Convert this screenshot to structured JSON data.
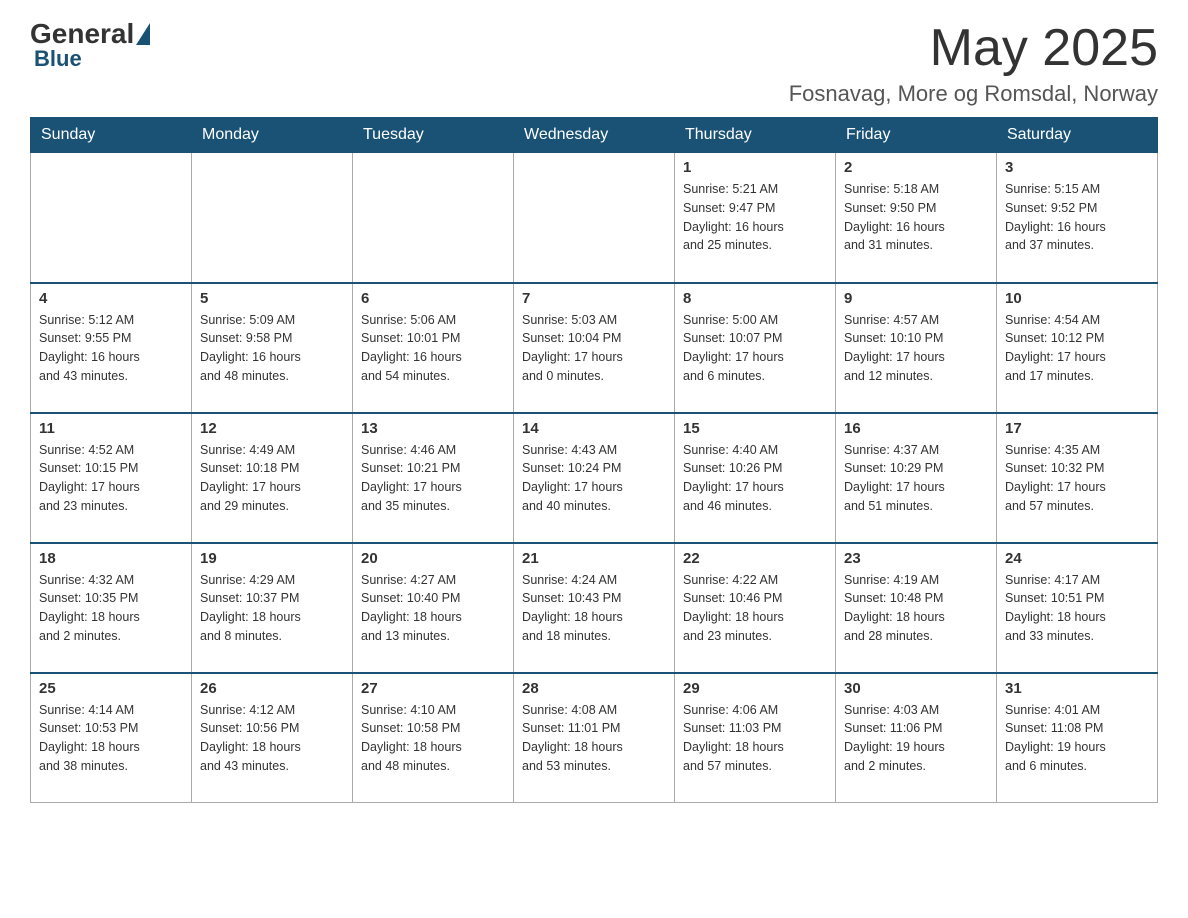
{
  "header": {
    "logo": {
      "general": "General",
      "blue": "Blue"
    },
    "title": "May 2025",
    "location": "Fosnavag, More og Romsdal, Norway"
  },
  "weekdays": [
    "Sunday",
    "Monday",
    "Tuesday",
    "Wednesday",
    "Thursday",
    "Friday",
    "Saturday"
  ],
  "weeks": [
    [
      {
        "day": "",
        "info": ""
      },
      {
        "day": "",
        "info": ""
      },
      {
        "day": "",
        "info": ""
      },
      {
        "day": "",
        "info": ""
      },
      {
        "day": "1",
        "info": "Sunrise: 5:21 AM\nSunset: 9:47 PM\nDaylight: 16 hours\nand 25 minutes."
      },
      {
        "day": "2",
        "info": "Sunrise: 5:18 AM\nSunset: 9:50 PM\nDaylight: 16 hours\nand 31 minutes."
      },
      {
        "day": "3",
        "info": "Sunrise: 5:15 AM\nSunset: 9:52 PM\nDaylight: 16 hours\nand 37 minutes."
      }
    ],
    [
      {
        "day": "4",
        "info": "Sunrise: 5:12 AM\nSunset: 9:55 PM\nDaylight: 16 hours\nand 43 minutes."
      },
      {
        "day": "5",
        "info": "Sunrise: 5:09 AM\nSunset: 9:58 PM\nDaylight: 16 hours\nand 48 minutes."
      },
      {
        "day": "6",
        "info": "Sunrise: 5:06 AM\nSunset: 10:01 PM\nDaylight: 16 hours\nand 54 minutes."
      },
      {
        "day": "7",
        "info": "Sunrise: 5:03 AM\nSunset: 10:04 PM\nDaylight: 17 hours\nand 0 minutes."
      },
      {
        "day": "8",
        "info": "Sunrise: 5:00 AM\nSunset: 10:07 PM\nDaylight: 17 hours\nand 6 minutes."
      },
      {
        "day": "9",
        "info": "Sunrise: 4:57 AM\nSunset: 10:10 PM\nDaylight: 17 hours\nand 12 minutes."
      },
      {
        "day": "10",
        "info": "Sunrise: 4:54 AM\nSunset: 10:12 PM\nDaylight: 17 hours\nand 17 minutes."
      }
    ],
    [
      {
        "day": "11",
        "info": "Sunrise: 4:52 AM\nSunset: 10:15 PM\nDaylight: 17 hours\nand 23 minutes."
      },
      {
        "day": "12",
        "info": "Sunrise: 4:49 AM\nSunset: 10:18 PM\nDaylight: 17 hours\nand 29 minutes."
      },
      {
        "day": "13",
        "info": "Sunrise: 4:46 AM\nSunset: 10:21 PM\nDaylight: 17 hours\nand 35 minutes."
      },
      {
        "day": "14",
        "info": "Sunrise: 4:43 AM\nSunset: 10:24 PM\nDaylight: 17 hours\nand 40 minutes."
      },
      {
        "day": "15",
        "info": "Sunrise: 4:40 AM\nSunset: 10:26 PM\nDaylight: 17 hours\nand 46 minutes."
      },
      {
        "day": "16",
        "info": "Sunrise: 4:37 AM\nSunset: 10:29 PM\nDaylight: 17 hours\nand 51 minutes."
      },
      {
        "day": "17",
        "info": "Sunrise: 4:35 AM\nSunset: 10:32 PM\nDaylight: 17 hours\nand 57 minutes."
      }
    ],
    [
      {
        "day": "18",
        "info": "Sunrise: 4:32 AM\nSunset: 10:35 PM\nDaylight: 18 hours\nand 2 minutes."
      },
      {
        "day": "19",
        "info": "Sunrise: 4:29 AM\nSunset: 10:37 PM\nDaylight: 18 hours\nand 8 minutes."
      },
      {
        "day": "20",
        "info": "Sunrise: 4:27 AM\nSunset: 10:40 PM\nDaylight: 18 hours\nand 13 minutes."
      },
      {
        "day": "21",
        "info": "Sunrise: 4:24 AM\nSunset: 10:43 PM\nDaylight: 18 hours\nand 18 minutes."
      },
      {
        "day": "22",
        "info": "Sunrise: 4:22 AM\nSunset: 10:46 PM\nDaylight: 18 hours\nand 23 minutes."
      },
      {
        "day": "23",
        "info": "Sunrise: 4:19 AM\nSunset: 10:48 PM\nDaylight: 18 hours\nand 28 minutes."
      },
      {
        "day": "24",
        "info": "Sunrise: 4:17 AM\nSunset: 10:51 PM\nDaylight: 18 hours\nand 33 minutes."
      }
    ],
    [
      {
        "day": "25",
        "info": "Sunrise: 4:14 AM\nSunset: 10:53 PM\nDaylight: 18 hours\nand 38 minutes."
      },
      {
        "day": "26",
        "info": "Sunrise: 4:12 AM\nSunset: 10:56 PM\nDaylight: 18 hours\nand 43 minutes."
      },
      {
        "day": "27",
        "info": "Sunrise: 4:10 AM\nSunset: 10:58 PM\nDaylight: 18 hours\nand 48 minutes."
      },
      {
        "day": "28",
        "info": "Sunrise: 4:08 AM\nSunset: 11:01 PM\nDaylight: 18 hours\nand 53 minutes."
      },
      {
        "day": "29",
        "info": "Sunrise: 4:06 AM\nSunset: 11:03 PM\nDaylight: 18 hours\nand 57 minutes."
      },
      {
        "day": "30",
        "info": "Sunrise: 4:03 AM\nSunset: 11:06 PM\nDaylight: 19 hours\nand 2 minutes."
      },
      {
        "day": "31",
        "info": "Sunrise: 4:01 AM\nSunset: 11:08 PM\nDaylight: 19 hours\nand 6 minutes."
      }
    ]
  ]
}
